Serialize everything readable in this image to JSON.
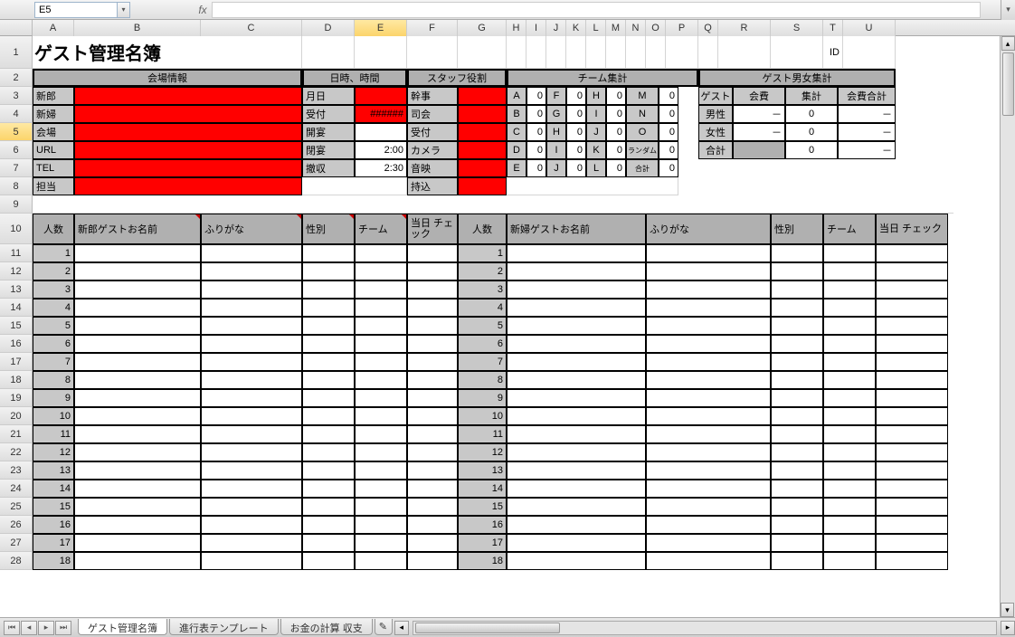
{
  "namebox": "E5",
  "fx": "fx",
  "title": "ゲスト管理名簿",
  "id_label": "ID",
  "sections": {
    "venue": "会場情報",
    "datetime": "日時、時間",
    "staff": "スタッフ役割",
    "team": "チーム集計",
    "guest_gender": "ゲスト男女集計"
  },
  "venue_labels": [
    "新郎",
    "新婦",
    "会場",
    "URL",
    "TEL",
    "担当"
  ],
  "datetime_labels": [
    "月日",
    "受付",
    "開宴",
    "閉宴",
    "撤収"
  ],
  "datetime_vals": [
    "",
    "######",
    "",
    "2:00",
    "2:30"
  ],
  "staff_labels": [
    "幹事",
    "司会",
    "受付",
    "カメラ",
    "音映",
    "持込"
  ],
  "team_rows": [
    [
      "A",
      "0",
      "F",
      "0",
      "H",
      "0",
      "M",
      "0"
    ],
    [
      "B",
      "0",
      "G",
      "0",
      "I",
      "0",
      "N",
      "0"
    ],
    [
      "C",
      "0",
      "H",
      "0",
      "J",
      "0",
      "O",
      "0"
    ],
    [
      "D",
      "0",
      "I",
      "0",
      "K",
      "0",
      "ランダム",
      "0"
    ],
    [
      "E",
      "0",
      "J",
      "0",
      "L",
      "0",
      "合計",
      "0"
    ]
  ],
  "gender_header": [
    "ゲスト",
    "会費",
    "集計",
    "会費合計"
  ],
  "gender_rows": [
    [
      "男性",
      "－",
      "0",
      "－"
    ],
    [
      "女性",
      "－",
      "0",
      "－"
    ],
    [
      "合計",
      "",
      "0",
      "－"
    ]
  ],
  "guest_table_headers_left": [
    "人数",
    "新郎ゲストお名前",
    "ふりがな",
    "性別",
    "チーム",
    "当日\nチェック"
  ],
  "guest_table_headers_right": [
    "人数",
    "新婦ゲストお名前",
    "ふりがな",
    "性別",
    "チーム",
    "当日\nチェック"
  ],
  "col_letters": [
    "A",
    "B",
    "C",
    "D",
    "E",
    "F",
    "G",
    "H",
    "I",
    "J",
    "K",
    "L",
    "M",
    "N",
    "O",
    "P",
    "Q",
    "R",
    "S",
    "T",
    "U"
  ],
  "sheet_tabs": [
    "ゲスト管理名簿",
    "進行表テンプレート",
    "お金の計算 収支"
  ],
  "row_numbers": [
    1,
    2,
    3,
    4,
    5,
    6,
    7,
    8,
    9,
    10,
    11,
    12,
    13,
    14,
    15,
    16,
    17,
    18,
    19,
    20,
    21,
    22,
    23,
    24,
    25,
    26,
    27,
    28
  ]
}
